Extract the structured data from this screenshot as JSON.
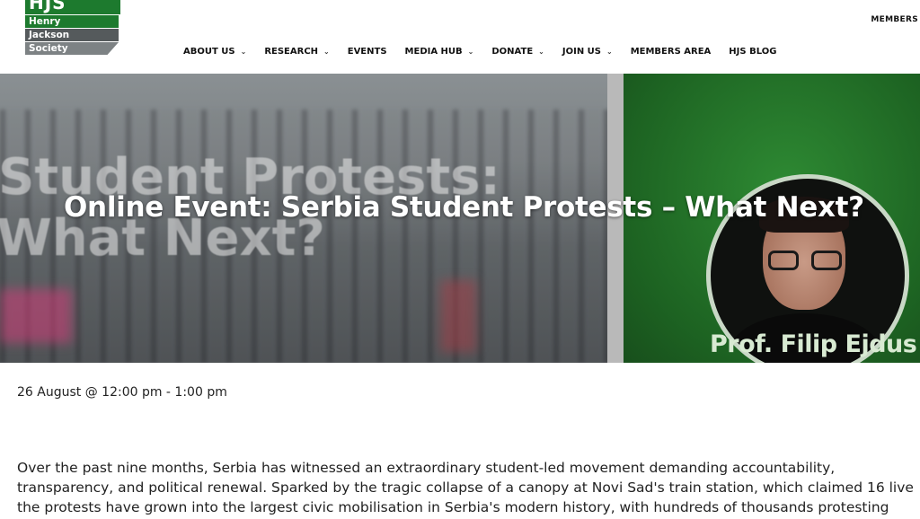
{
  "header": {
    "logo_text": "HJS",
    "logo_lines": [
      "Henry",
      "Jackson",
      "Society"
    ],
    "top_link": "MEMBERS"
  },
  "nav": [
    {
      "label": "ABOUT US",
      "has_dropdown": true
    },
    {
      "label": "RESEARCH",
      "has_dropdown": true
    },
    {
      "label": "EVENTS",
      "has_dropdown": false
    },
    {
      "label": "MEDIA HUB",
      "has_dropdown": true
    },
    {
      "label": "DONATE",
      "has_dropdown": true
    },
    {
      "label": "JOIN US",
      "has_dropdown": true
    },
    {
      "label": "MEMBERS AREA",
      "has_dropdown": false
    },
    {
      "label": "HJS BLOG",
      "has_dropdown": false
    }
  ],
  "banner": {
    "bg_text_line1": "Student Protests:",
    "bg_text_line2": "What Next?",
    "title": "Online Event: Serbia Student Protests – What Next?",
    "speaker_name": "Prof. Filip Ejdus",
    "accent_green": "#1d6322"
  },
  "event": {
    "date_time": "26 August @ 12:00 pm - 1:00 pm",
    "description_lines": [
      "Over the past nine months, Serbia has witnessed an extraordinary student-led movement demanding accountability,",
      "transparency, and political renewal. Sparked by the tragic collapse of a canopy at Novi Sad's train station, which claimed 16 live",
      "the protests have grown into the largest civic mobilisation in Serbia's modern history, with hundreds of thousands protesting"
    ]
  },
  "icons": {
    "dropdown": "chevron-down-icon"
  }
}
